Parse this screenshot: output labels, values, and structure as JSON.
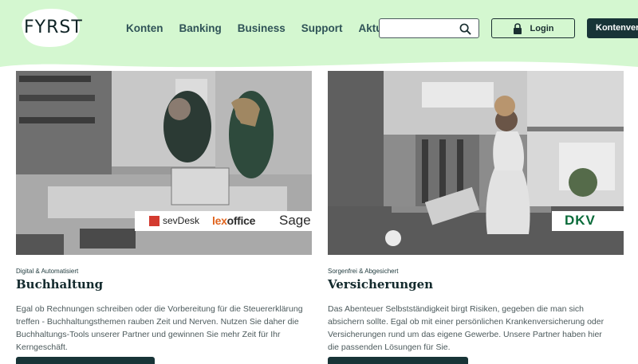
{
  "header": {
    "logo_text": "FYRST",
    "nav": [
      "Konten",
      "Banking",
      "Business",
      "Support",
      "Aktuelles"
    ],
    "search_placeholder": "",
    "login_label": "Login",
    "cta_label": "Kontenvergleich"
  },
  "cards": [
    {
      "kicker": "Digital & Automatisiert",
      "title": "Buchhaltung",
      "text": "Egal ob Rechnungen schreiben oder die Vorbereitung für die Steuererklärung treffen - Buchhaltungsthemen rauben Zeit und Nerven. Nutzen Sie daher die Buchhaltungs-Tools unserer Partner und gewinnen Sie mehr Zeit für Ihr Kerngeschäft.",
      "partners": {
        "sevdesk": "sevDesk",
        "lexoffice_lex": "lex",
        "lexoffice_rest": "office",
        "sage": "Sage"
      }
    },
    {
      "kicker": "Sorgenfrei & Abgesichert",
      "title": "Versicherungen",
      "text": "Das Abenteuer Selbstständigkeit birgt Risiken, gegeben die man sich absichern sollte. Egal ob mit einer persönlichen Krankenversicherung oder Versicherungen rund um das eigene Gewerbe. Unsere Partner haben hier die passenden Lösungen für Sie.",
      "partner": "DKV"
    }
  ],
  "colors": {
    "header_bg": "#d4f7d0",
    "dark": "#183437",
    "nav": "#2f5357"
  }
}
